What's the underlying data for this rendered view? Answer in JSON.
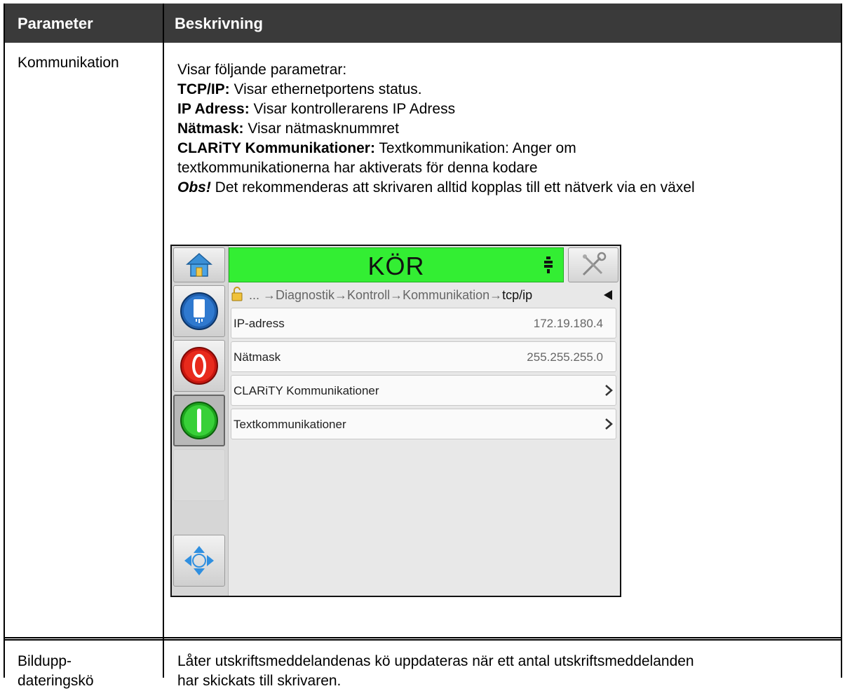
{
  "table": {
    "header": {
      "col1": "Parameter",
      "col2": "Beskrivning"
    },
    "rows": [
      {
        "param": "Kommunikation",
        "desc_lines": [
          {
            "text": "Visar följande parametrar:"
          },
          {
            "bold": "TCP/IP:",
            "text": " Visar ethernetportens status."
          },
          {
            "bold": "IP Adress:",
            "text": " Visar kontrollerarens IP Adress"
          },
          {
            "bold": "Nätmask:",
            "text": " Visar nätmasknummret"
          },
          {
            "bold": "CLARiTY Kommunikationer:",
            "text": " Textkommunikation: Anger om"
          },
          {
            "text": "textkommunikationerna har aktiverats för denna kodare"
          },
          {
            "bold_italic": "Obs!",
            "text": " Det rekommenderas att skrivaren alltid kopplas till ett nätverk via en växel"
          }
        ]
      },
      {
        "param_lines": [
          "Bildupp-",
          "dateringskö"
        ],
        "desc_lines": [
          "Låter utskriftsmeddelandenas kö uppdateras när ett antal utskriftsmeddelanden",
          "har skickats till skrivaren."
        ]
      }
    ]
  },
  "device": {
    "status_text": "KÖR",
    "status_color": "#33ee33",
    "icons": [
      "home-icon",
      "message-icon",
      "stop-icon",
      "start-icon",
      "navigate-icon",
      "tools-icon",
      "lock-icon",
      "printhead-icon"
    ],
    "breadcrumb": {
      "prefix": "... →Diagnostik→Kontroll→Kommunikation→",
      "current": "tcp/ip"
    },
    "rows": [
      {
        "label": "IP-adress",
        "value": "172.19.180.4"
      },
      {
        "label": "Nätmask",
        "value": "255.255.255.0"
      },
      {
        "label": "CLARiTY Kommunikationer",
        "value": ""
      },
      {
        "label": "Textkommunikationer",
        "value": ""
      }
    ]
  }
}
